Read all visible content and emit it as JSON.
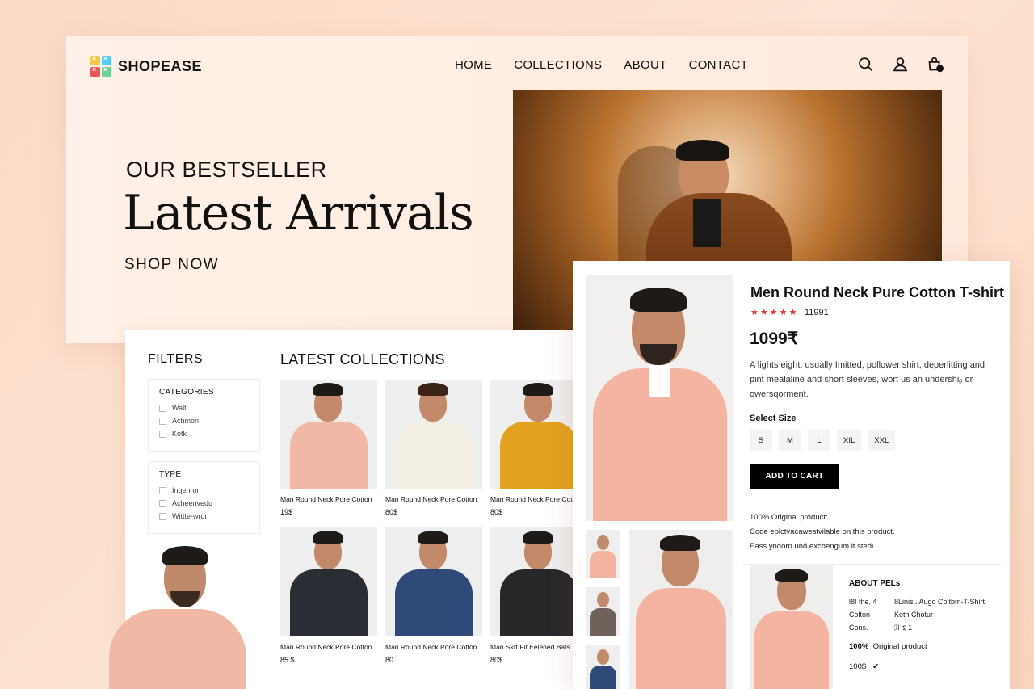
{
  "brand": {
    "name": "SHOPEASE",
    "colors": [
      "#f2c94c",
      "#56ccf2",
      "#eb5757",
      "#6fcf97"
    ]
  },
  "nav": {
    "items": [
      "HOME",
      "COLLECTIONS",
      "ABOUT",
      "CONTACT"
    ]
  },
  "nav_icons": [
    "search-icon",
    "user-icon",
    "cart-icon"
  ],
  "hero": {
    "subtitle": "OUR BESTSELLER",
    "title": "Latest Arrivals",
    "cta": "SHOP NOW"
  },
  "filters": {
    "title": "FILTERS",
    "categories": {
      "title": "CATEGORIES",
      "options": [
        "Walt",
        "Achmon",
        "Kotk"
      ]
    },
    "type": {
      "title": "TYPE",
      "options": [
        "Ingenron",
        "Acheenvedu",
        "Wittte-wron"
      ]
    }
  },
  "collections": {
    "title": "LATEST COLLECTIONS",
    "products": [
      {
        "name": "Man Round Neck Pore Cotton",
        "price": "19$",
        "shirt": "#f2b8a6",
        "hair": "#1e1a17"
      },
      {
        "name": "Man Round Neck Pore Cotton",
        "price": "80$",
        "shirt": "#f3efe2",
        "hair": "#3b2416"
      },
      {
        "name": "Man Round Neck Pore Cotton",
        "price": "80$",
        "shirt": "#e3a21f",
        "hair": "#1e1a17"
      },
      {
        "name": "Man Round Neck Pore Cotton",
        "price": "85 $",
        "shirt": "#2a2d33",
        "hair": "#1e1a17"
      },
      {
        "name": "Man Round Neck Pore Cotton",
        "price": "80",
        "shirt": "#2f4a78",
        "hair": "#1e1a17"
      },
      {
        "name": "Man Skrt Fit Eelened Bats",
        "price": "80$",
        "shirt": "#27272a",
        "hair": "#1e1a17"
      }
    ]
  },
  "product": {
    "title": "Men Round Neck Pure Cotton T-shirt",
    "stars": "★★★★★",
    "reviews": "11991",
    "price": "1099₹",
    "description": "A lights eight, usually Imitted, pollower shirt, deperlitting and pint mealaline and short sleeves, wort us an undershiᵨ or owersqorment.",
    "size_label": "Select Size",
    "sizes": [
      "S",
      "M",
      "L",
      "XIL",
      "XXL"
    ],
    "add_to_cart": "ADD TO CART",
    "info": [
      "100% Original product:",
      "Code eplctvacawestvilable on this product.",
      "Eass yndorn und exchengum it stedᵻ"
    ],
    "about": {
      "title": "ABOUT PELs",
      "rows": [
        {
          "k": "Ɩ8I the. 4",
          "v": "8Linis.. Augo Coltbm-T-Shirt"
        },
        {
          "k": "Colton",
          "v": "Keth Chotur"
        },
        {
          "k": "Cons.",
          "v": "ℐl ኚ 1"
        }
      ],
      "original_pct": "100%",
      "original_label": "Original product",
      "price": "100$",
      "price_mark": "✔"
    }
  }
}
